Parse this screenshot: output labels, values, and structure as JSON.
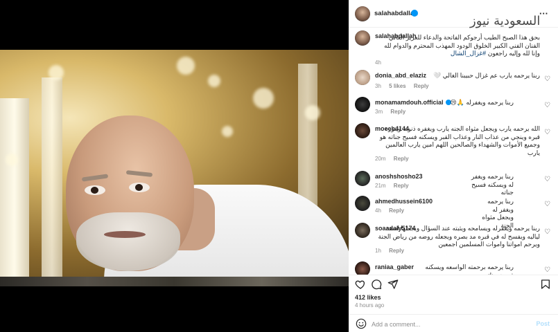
{
  "header": {
    "username": "salahabdallah",
    "more_icon": "more-horizontal-icon",
    "watermark": "السعودية نيوز"
  },
  "caption": {
    "username": "salahabdallah",
    "text": "بحق هذا الصبح الطيب أرجوكم الفاتحة والدعاء للعزيز الغالي الفنان الفني الكبير الخلوق الودود المهذب المحترم",
    "text2": "والدوام لله وإنا لله وإليه راجعون",
    "hashtag": "#غزال_الشال",
    "time": "4h"
  },
  "comments": [
    {
      "username": "donia_abd_elaziz",
      "text": "ربنا يرحمه يارب عم غزال حبيبنا الغالي 🤍",
      "time": "3h",
      "likes": "5 likes",
      "reply": "Reply",
      "verified": false
    },
    {
      "username": "monamamdouh.official",
      "text": "ربنا يرحمه ويغفرله 🙏😢",
      "time": "3m",
      "likes": "",
      "reply": "Reply",
      "verified": true
    },
    {
      "username": "moeeh4144",
      "text": "الله يرحمه يارب ويجعل مثواه الجنه يارب ويغفره ذنوبه وينوره قبره وينجي من عذاب النار وعذاب القبر ويسكنه فسيح جناته هو وجميع الأموات والشهداء والصالحين اللهم امين يارب العالمين يارب",
      "time": "20m",
      "likes": "",
      "reply": "Reply",
      "verified": false
    },
    {
      "username": "anoshshosho23",
      "text": "ربنا يرحمه ويغفر له ويسكنه فسيح جناته",
      "time": "21m",
      "likes": "",
      "reply": "Reply",
      "verified": false
    },
    {
      "username": "ahmedhussein6100",
      "text": "ربنا يرحمه ويغفر له ويجعل مثواه الجنة",
      "time": "4h",
      "likes": "",
      "reply": "Reply",
      "verified": false
    },
    {
      "username": "soaadaly5174",
      "text": "ربنا يرحمه ويغفرله ويسامحه ويثبته عند السؤال ويجعلها اسعد لياليه ويفسح له في قبره مد بصره ويجعله روضه من رياض الجنة ويرحم امواتنا واموات المسلمين اجمعين",
      "time": "1h",
      "likes": "",
      "reply": "Reply",
      "verified": false
    },
    {
      "username": "raniaa_gaber",
      "text": "ربنا يرحمه برحمته الواسعه ويسكنه فسيح جناته",
      "time": "",
      "likes": "",
      "reply": "",
      "verified": false
    }
  ],
  "actions": {
    "likes": "412 likes",
    "time": "4 hours ago",
    "comment_placeholder": "Add a comment...",
    "post_label": "Post"
  },
  "colors": {
    "verified": "#0095f6",
    "post_button": "#b2dffc",
    "muted_text": "#8e8e8e"
  }
}
